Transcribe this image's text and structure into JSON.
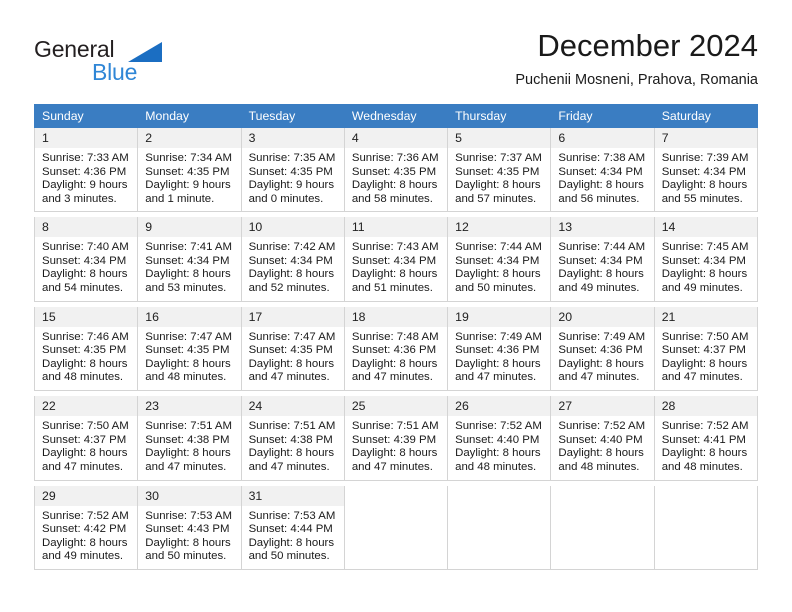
{
  "logo": {
    "word_top": "General",
    "word_bottom": "Blue",
    "triangle_color": "#1b6ec2",
    "blue_text_color": "#2f86d6"
  },
  "header": {
    "title": "December 2024",
    "subtitle": "Puchenii Mosneni, Prahova, Romania"
  },
  "theme": {
    "header_bg": "#3a7dc2",
    "header_text": "#ffffff",
    "daynum_bg": "#f1f1f1",
    "cell_border": "#d4d4d4"
  },
  "calendar": {
    "weekday_headers": [
      "Sunday",
      "Monday",
      "Tuesday",
      "Wednesday",
      "Thursday",
      "Friday",
      "Saturday"
    ],
    "weeks": [
      [
        {
          "day": "1",
          "sunrise": "Sunrise: 7:33 AM",
          "sunset": "Sunset: 4:36 PM",
          "daylight1": "Daylight: 9 hours",
          "daylight2": "and 3 minutes."
        },
        {
          "day": "2",
          "sunrise": "Sunrise: 7:34 AM",
          "sunset": "Sunset: 4:35 PM",
          "daylight1": "Daylight: 9 hours",
          "daylight2": "and 1 minute."
        },
        {
          "day": "3",
          "sunrise": "Sunrise: 7:35 AM",
          "sunset": "Sunset: 4:35 PM",
          "daylight1": "Daylight: 9 hours",
          "daylight2": "and 0 minutes."
        },
        {
          "day": "4",
          "sunrise": "Sunrise: 7:36 AM",
          "sunset": "Sunset: 4:35 PM",
          "daylight1": "Daylight: 8 hours",
          "daylight2": "and 58 minutes."
        },
        {
          "day": "5",
          "sunrise": "Sunrise: 7:37 AM",
          "sunset": "Sunset: 4:35 PM",
          "daylight1": "Daylight: 8 hours",
          "daylight2": "and 57 minutes."
        },
        {
          "day": "6",
          "sunrise": "Sunrise: 7:38 AM",
          "sunset": "Sunset: 4:34 PM",
          "daylight1": "Daylight: 8 hours",
          "daylight2": "and 56 minutes."
        },
        {
          "day": "7",
          "sunrise": "Sunrise: 7:39 AM",
          "sunset": "Sunset: 4:34 PM",
          "daylight1": "Daylight: 8 hours",
          "daylight2": "and 55 minutes."
        }
      ],
      [
        {
          "day": "8",
          "sunrise": "Sunrise: 7:40 AM",
          "sunset": "Sunset: 4:34 PM",
          "daylight1": "Daylight: 8 hours",
          "daylight2": "and 54 minutes."
        },
        {
          "day": "9",
          "sunrise": "Sunrise: 7:41 AM",
          "sunset": "Sunset: 4:34 PM",
          "daylight1": "Daylight: 8 hours",
          "daylight2": "and 53 minutes."
        },
        {
          "day": "10",
          "sunrise": "Sunrise: 7:42 AM",
          "sunset": "Sunset: 4:34 PM",
          "daylight1": "Daylight: 8 hours",
          "daylight2": "and 52 minutes."
        },
        {
          "day": "11",
          "sunrise": "Sunrise: 7:43 AM",
          "sunset": "Sunset: 4:34 PM",
          "daylight1": "Daylight: 8 hours",
          "daylight2": "and 51 minutes."
        },
        {
          "day": "12",
          "sunrise": "Sunrise: 7:44 AM",
          "sunset": "Sunset: 4:34 PM",
          "daylight1": "Daylight: 8 hours",
          "daylight2": "and 50 minutes."
        },
        {
          "day": "13",
          "sunrise": "Sunrise: 7:44 AM",
          "sunset": "Sunset: 4:34 PM",
          "daylight1": "Daylight: 8 hours",
          "daylight2": "and 49 minutes."
        },
        {
          "day": "14",
          "sunrise": "Sunrise: 7:45 AM",
          "sunset": "Sunset: 4:34 PM",
          "daylight1": "Daylight: 8 hours",
          "daylight2": "and 49 minutes."
        }
      ],
      [
        {
          "day": "15",
          "sunrise": "Sunrise: 7:46 AM",
          "sunset": "Sunset: 4:35 PM",
          "daylight1": "Daylight: 8 hours",
          "daylight2": "and 48 minutes."
        },
        {
          "day": "16",
          "sunrise": "Sunrise: 7:47 AM",
          "sunset": "Sunset: 4:35 PM",
          "daylight1": "Daylight: 8 hours",
          "daylight2": "and 48 minutes."
        },
        {
          "day": "17",
          "sunrise": "Sunrise: 7:47 AM",
          "sunset": "Sunset: 4:35 PM",
          "daylight1": "Daylight: 8 hours",
          "daylight2": "and 47 minutes."
        },
        {
          "day": "18",
          "sunrise": "Sunrise: 7:48 AM",
          "sunset": "Sunset: 4:36 PM",
          "daylight1": "Daylight: 8 hours",
          "daylight2": "and 47 minutes."
        },
        {
          "day": "19",
          "sunrise": "Sunrise: 7:49 AM",
          "sunset": "Sunset: 4:36 PM",
          "daylight1": "Daylight: 8 hours",
          "daylight2": "and 47 minutes."
        },
        {
          "day": "20",
          "sunrise": "Sunrise: 7:49 AM",
          "sunset": "Sunset: 4:36 PM",
          "daylight1": "Daylight: 8 hours",
          "daylight2": "and 47 minutes."
        },
        {
          "day": "21",
          "sunrise": "Sunrise: 7:50 AM",
          "sunset": "Sunset: 4:37 PM",
          "daylight1": "Daylight: 8 hours",
          "daylight2": "and 47 minutes."
        }
      ],
      [
        {
          "day": "22",
          "sunrise": "Sunrise: 7:50 AM",
          "sunset": "Sunset: 4:37 PM",
          "daylight1": "Daylight: 8 hours",
          "daylight2": "and 47 minutes."
        },
        {
          "day": "23",
          "sunrise": "Sunrise: 7:51 AM",
          "sunset": "Sunset: 4:38 PM",
          "daylight1": "Daylight: 8 hours",
          "daylight2": "and 47 minutes."
        },
        {
          "day": "24",
          "sunrise": "Sunrise: 7:51 AM",
          "sunset": "Sunset: 4:38 PM",
          "daylight1": "Daylight: 8 hours",
          "daylight2": "and 47 minutes."
        },
        {
          "day": "25",
          "sunrise": "Sunrise: 7:51 AM",
          "sunset": "Sunset: 4:39 PM",
          "daylight1": "Daylight: 8 hours",
          "daylight2": "and 47 minutes."
        },
        {
          "day": "26",
          "sunrise": "Sunrise: 7:52 AM",
          "sunset": "Sunset: 4:40 PM",
          "daylight1": "Daylight: 8 hours",
          "daylight2": "and 48 minutes."
        },
        {
          "day": "27",
          "sunrise": "Sunrise: 7:52 AM",
          "sunset": "Sunset: 4:40 PM",
          "daylight1": "Daylight: 8 hours",
          "daylight2": "and 48 minutes."
        },
        {
          "day": "28",
          "sunrise": "Sunrise: 7:52 AM",
          "sunset": "Sunset: 4:41 PM",
          "daylight1": "Daylight: 8 hours",
          "daylight2": "and 48 minutes."
        }
      ],
      [
        {
          "day": "29",
          "sunrise": "Sunrise: 7:52 AM",
          "sunset": "Sunset: 4:42 PM",
          "daylight1": "Daylight: 8 hours",
          "daylight2": "and 49 minutes."
        },
        {
          "day": "30",
          "sunrise": "Sunrise: 7:53 AM",
          "sunset": "Sunset: 4:43 PM",
          "daylight1": "Daylight: 8 hours",
          "daylight2": "and 50 minutes."
        },
        {
          "day": "31",
          "sunrise": "Sunrise: 7:53 AM",
          "sunset": "Sunset: 4:44 PM",
          "daylight1": "Daylight: 8 hours",
          "daylight2": "and 50 minutes."
        },
        null,
        null,
        null,
        null
      ]
    ]
  }
}
